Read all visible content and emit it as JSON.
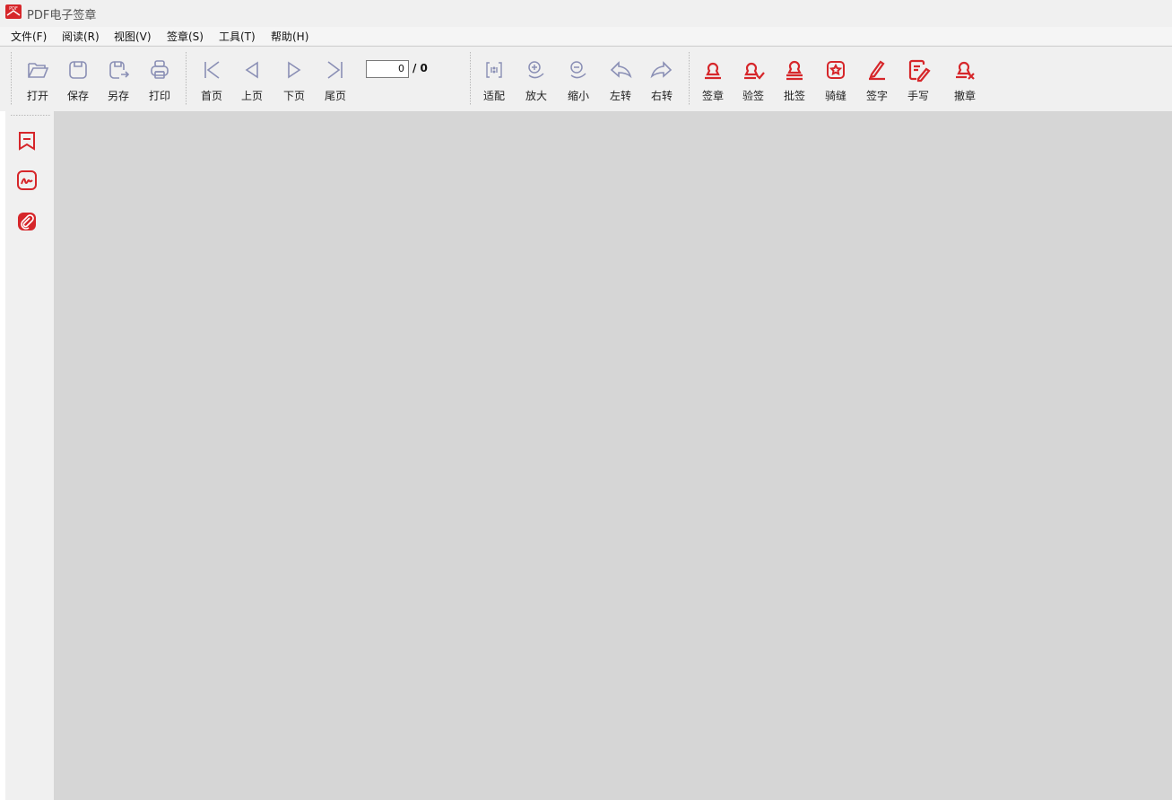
{
  "window": {
    "title": "PDF电子签章",
    "app_icon_text": "PDF"
  },
  "menu": [
    "文件(F)",
    "阅读(R)",
    "视图(V)",
    "签章(S)",
    "工具(T)",
    "帮助(H)"
  ],
  "toolbar": {
    "file": [
      "打开",
      "保存",
      "另存",
      "打印"
    ],
    "nav": [
      "首页",
      "上页",
      "下页",
      "尾页"
    ],
    "page_current": "0",
    "page_total": "/ 0",
    "view": [
      "适配",
      "放大",
      "缩小",
      "左转",
      "右转"
    ],
    "sign": [
      "签章",
      "验签",
      "批签",
      "骑缝",
      "签字",
      "手写",
      "撤章"
    ]
  },
  "icons": {
    "open": "folder-open-icon",
    "save": "save-icon",
    "saveas": "save-as-icon",
    "print": "print-icon",
    "first": "first-page-icon",
    "prev": "prev-page-icon",
    "next": "next-page-icon",
    "last": "last-page-icon",
    "fit": "fit-page-icon",
    "zoomin": "zoom-in-icon",
    "zoomout": "zoom-out-icon",
    "rotleft": "rotate-left-icon",
    "rotright": "rotate-right-icon",
    "stamp": "stamp-icon",
    "verify": "verify-stamp-icon",
    "batch": "batch-stamp-icon",
    "seam": "seam-stamp-icon",
    "signname": "signature-pen-icon",
    "handwrite": "handwrite-icon",
    "revoke": "revoke-stamp-icon",
    "side_bookmark": "bookmark-icon",
    "side_signature": "signature-icon",
    "side_attachment": "attachment-icon"
  },
  "colors": {
    "accent_red": "#d6262a",
    "disabled_icon": "#8a8fb5",
    "workarea": "#d6d6d6"
  }
}
